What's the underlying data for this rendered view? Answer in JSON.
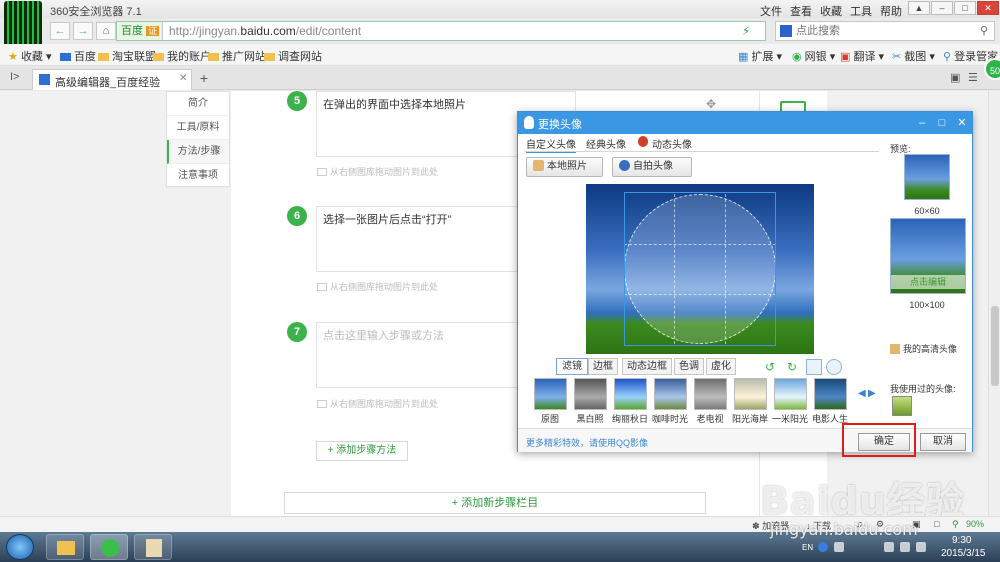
{
  "browser": {
    "title": "360安全浏览器 7.1",
    "menu": [
      "文件",
      "查看",
      "收藏",
      "工具",
      "帮助"
    ],
    "url_prefix": "http://jingyan.",
    "url_domain": "baidu.com",
    "url_path": "/edit/content",
    "site_name": "百度",
    "cert_label": "证",
    "search_placeholder": "点此搜索",
    "tab_label": "高级编辑器_百度经验",
    "new_tab_symbol": "+",
    "badge": "50"
  },
  "bookmarks": {
    "left": [
      "收藏",
      "百度",
      "淘宝联盟",
      "我的账户",
      "推广网站",
      "调查网站"
    ],
    "right": [
      "扩展",
      "网银",
      "翻译",
      "截图",
      "登录管家"
    ]
  },
  "side_nav": [
    "简介",
    "工具/原料",
    "方法/步骤",
    "注意事项"
  ],
  "steps": [
    {
      "num": "5",
      "text": "在弹出的界面中选择本地照片",
      "hint": "从右侧图库拖动图片到此处"
    },
    {
      "num": "6",
      "text": "选择一张图片后点击“打开”",
      "hint": "从右侧图库拖动图片到此处"
    },
    {
      "num": "7",
      "placeholder": "点击这里输入步骤或方法",
      "hint": "从右侧图库拖动图片到此处"
    }
  ],
  "add_method": "+ 添加步骤方法",
  "add_section": "+ 添加新步骤栏目",
  "dialog": {
    "title": "更换头像",
    "tabs": [
      "自定义头像",
      "经典头像",
      "动态头像"
    ],
    "local_photo": "本地照片",
    "selfie": "自拍头像",
    "filter_tabs": [
      "滤镜",
      "边框",
      "动态边框",
      "色调",
      "虚化"
    ],
    "filters": [
      "原图",
      "黑白照",
      "绚丽秋日",
      "咖啡时光",
      "老电视",
      "阳光海岸",
      "一米阳光",
      "电影人生"
    ],
    "preview_label": "预览:",
    "size_small": "60×60",
    "size_large": "100×100",
    "click_edit": "点击编辑",
    "hd_avatar": "我的高清头像",
    "used_label": "我使用过的头像:",
    "more_effects": "更多精彩特效，请使用QQ影像",
    "ok": "确定",
    "cancel": "取消"
  },
  "status": {
    "accelerator": "加速器",
    "download": "下载",
    "zoom": "90%"
  },
  "taskbar": {
    "lang": "EN",
    "time": "9:30",
    "date": "2015/3/15"
  },
  "watermark": {
    "brand": "Baidu经验",
    "url": "jingyan.baidu.com"
  }
}
